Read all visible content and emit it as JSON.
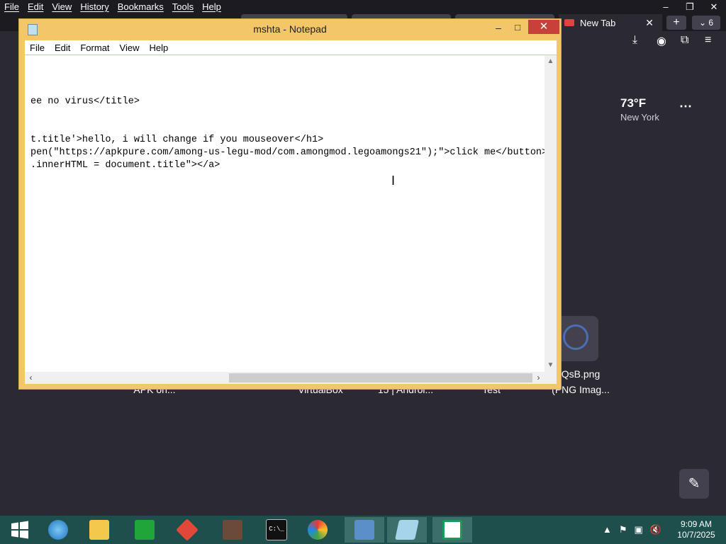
{
  "browser": {
    "menu": [
      "File",
      "Edit",
      "View",
      "History",
      "Bookmarks",
      "Tools",
      "Help"
    ],
    "window_controls": [
      "–",
      "❐",
      "✕"
    ],
    "active_tab": {
      "title": "New Tab",
      "close": "✕"
    },
    "new_tab": "+",
    "tab_list": "⌄ 6"
  },
  "new_tab_page": {
    "weather": {
      "temperature": "73°F",
      "city": "New York",
      "more": "⋯"
    },
    "shortcut_labels": [
      {
        "line1": "",
        "line2": "APK on..."
      },
      {
        "line1": "",
        "line2": "VirtualBox"
      },
      {
        "line1": "",
        "line2": "15 | Androi..."
      },
      {
        "line1": "",
        "line2": "Test"
      },
      {
        "line1": "QsB.png",
        "line2": "(PNG Imag..."
      }
    ]
  },
  "notepad": {
    "title": "mshta - Notepad",
    "menu": [
      "File",
      "Edit",
      "Format",
      "View",
      "Help"
    ],
    "lines": [
      "ee no virus</title>",
      "t.title'>hello, i will change if you mouseover</h1>",
      "pen(\"https://apkpure.com/among-us-legu-mod/com.amongmod.legoamongs21\");\">click me</button>",
      ".innerHTML = document.title\"></a>"
    ]
  },
  "taskbar": {
    "apps": [
      "start",
      "internet-explorer",
      "file-explorer",
      "store",
      "virtualbox",
      "image-app",
      "command-prompt",
      "paint",
      "remote-desktop",
      "notepad",
      "home-app"
    ],
    "tray_icons": [
      "▲",
      "⚑",
      "▣",
      "🔇"
    ],
    "time": "9:09 AM",
    "date": "10/7/2025"
  },
  "colors": {
    "notepad_frame": "#f3c669",
    "close_button": "#c7413b",
    "taskbar": "#1f4f4c",
    "browser_bg": "#2b2a33"
  }
}
